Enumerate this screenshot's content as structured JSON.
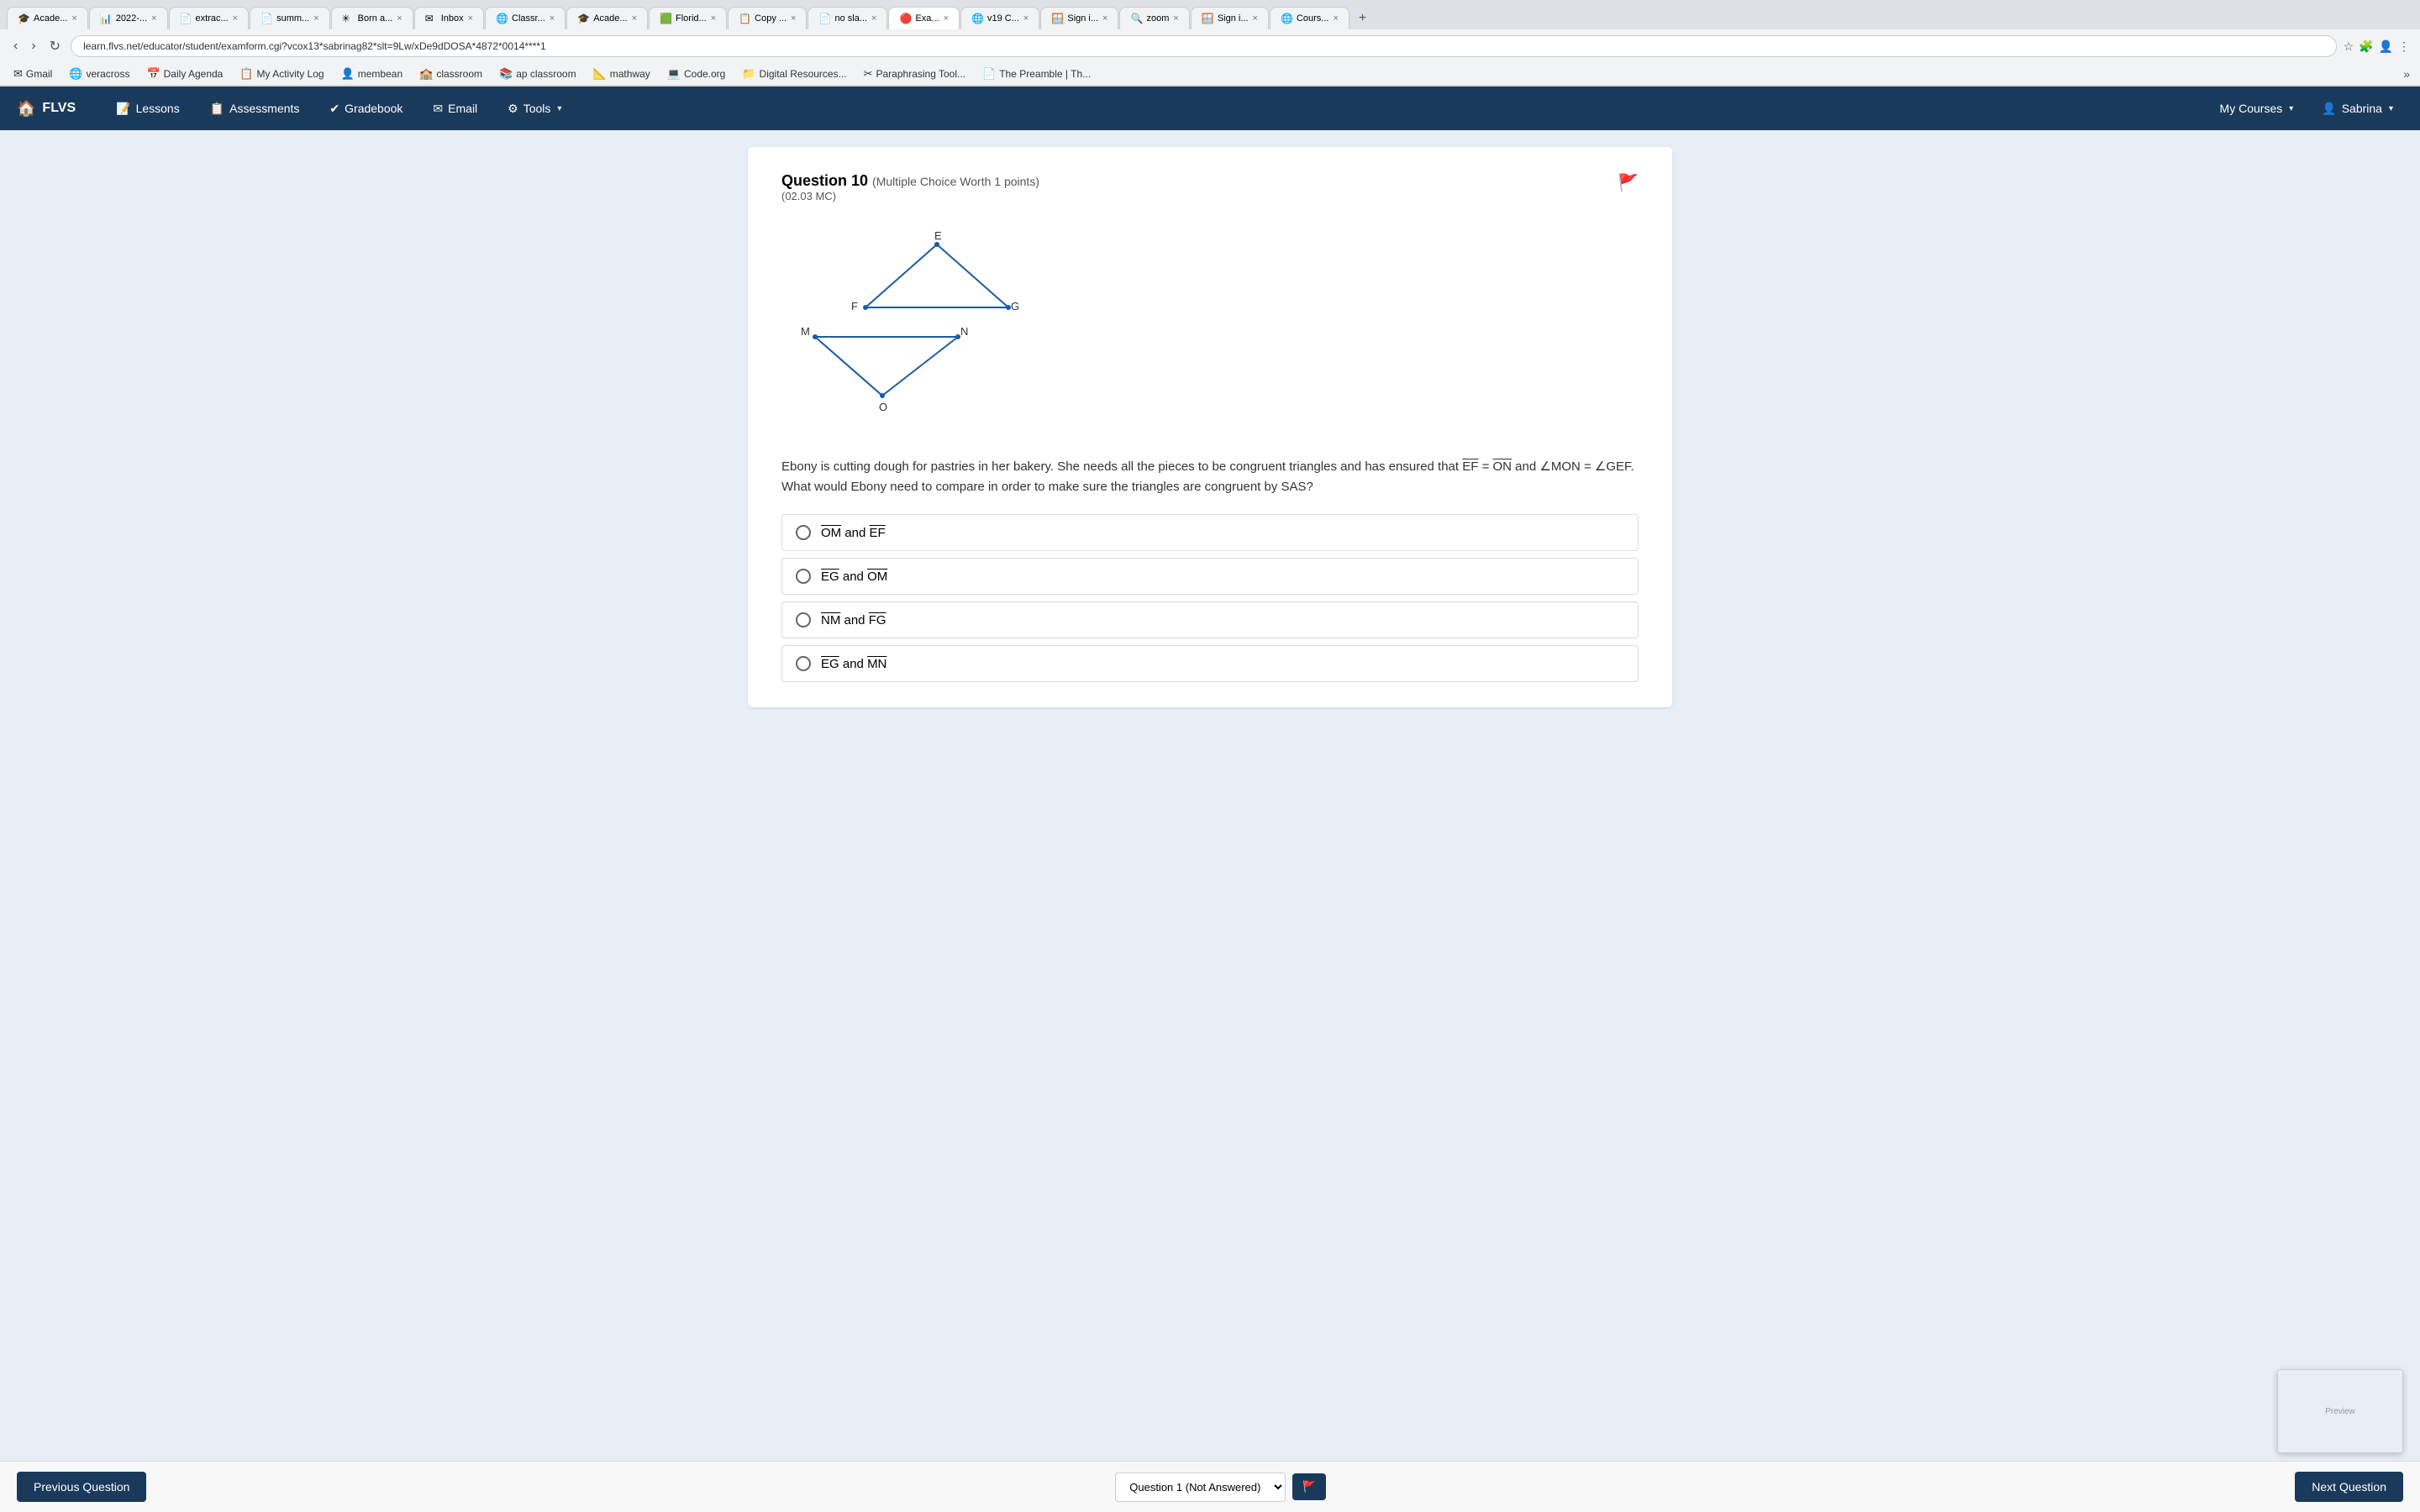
{
  "browser": {
    "tabs": [
      {
        "id": "t1",
        "favicon": "🎓",
        "title": "Acade...",
        "active": false
      },
      {
        "id": "t2",
        "favicon": "📊",
        "title": "2022-...",
        "active": false
      },
      {
        "id": "t3",
        "favicon": "📄",
        "title": "extrac...",
        "active": false
      },
      {
        "id": "t4",
        "favicon": "📄",
        "title": "summ...",
        "active": false
      },
      {
        "id": "t5",
        "favicon": "✳",
        "title": "Born a...",
        "active": false
      },
      {
        "id": "t6",
        "favicon": "✉",
        "title": "Inbox",
        "active": false
      },
      {
        "id": "t7",
        "favicon": "🌐",
        "title": "Classr...",
        "active": false
      },
      {
        "id": "t8",
        "favicon": "🎓",
        "title": "Acade...",
        "active": false
      },
      {
        "id": "t9",
        "favicon": "🟩",
        "title": "Florid...",
        "active": false
      },
      {
        "id": "t10",
        "favicon": "📋",
        "title": "Copy ...",
        "active": false
      },
      {
        "id": "t11",
        "favicon": "📄",
        "title": "no sla...",
        "active": false
      },
      {
        "id": "t12",
        "favicon": "🔴",
        "title": "Exa...",
        "active": true
      },
      {
        "id": "t13",
        "favicon": "🌐",
        "title": "v19 C...",
        "active": false
      },
      {
        "id": "t14",
        "favicon": "🪟",
        "title": "Sign i...",
        "active": false
      },
      {
        "id": "t15",
        "favicon": "🔍",
        "title": "zoom",
        "active": false
      },
      {
        "id": "t16",
        "favicon": "🪟",
        "title": "Sign i...",
        "active": false
      },
      {
        "id": "t17",
        "favicon": "🌐",
        "title": "Cours...",
        "active": false
      }
    ],
    "url": "learn.flvs.net/educator/student/examform.cgi?vcox13*sabrinag82*slt=9Lw/xDe9dDOSA*4872*0014****1"
  },
  "bookmarks": [
    {
      "icon": "✉",
      "label": "Gmail"
    },
    {
      "icon": "🌐",
      "label": "veracross"
    },
    {
      "icon": "📅",
      "label": "Daily Agenda"
    },
    {
      "icon": "📋",
      "label": "My Activity Log"
    },
    {
      "icon": "👤",
      "label": "membean"
    },
    {
      "icon": "🏫",
      "label": "classroom"
    },
    {
      "icon": "📚",
      "label": "ap classroom"
    },
    {
      "icon": "📐",
      "label": "mathway"
    },
    {
      "icon": "💻",
      "label": "Code.org"
    },
    {
      "icon": "📁",
      "label": "Digital Resources..."
    },
    {
      "icon": "✂",
      "label": "Paraphrasing Tool..."
    },
    {
      "icon": "📄",
      "label": "The Preamble | Th..."
    }
  ],
  "nav": {
    "brand": "FLVS",
    "links": [
      {
        "icon": "📝",
        "label": "Lessons"
      },
      {
        "icon": "📋",
        "label": "Assessments"
      },
      {
        "icon": "✔",
        "label": "Gradebook"
      },
      {
        "icon": "✉",
        "label": "Email"
      },
      {
        "icon": "⚙",
        "label": "Tools",
        "dropdown": true
      }
    ],
    "right": [
      {
        "label": "My Courses",
        "dropdown": true
      },
      {
        "label": "Sabrina",
        "dropdown": true
      }
    ]
  },
  "question": {
    "number": "Question 10",
    "type": "(Multiple Choice Worth 1 points)",
    "code": "(02.03 MC)",
    "text": "Ebony is cutting dough for pastries in her bakery. She needs all the pieces to be congruent triangles and has ensured that",
    "text2": "= ",
    "text3": "and ∠MON = ∠GEF. What would Ebony need to compare in order to make sure the triangles are congruent by SAS?",
    "given1": "EF",
    "given2": "ON",
    "choices": [
      {
        "id": "a",
        "text1": "OM",
        "conj": " and ",
        "text2": "EF",
        "overline1": true,
        "overline2": true
      },
      {
        "id": "b",
        "text1": "EG",
        "conj": " and ",
        "text2": "OM",
        "overline1": true,
        "overline2": true
      },
      {
        "id": "c",
        "text1": "NM",
        "conj": " and ",
        "text2": "FG",
        "overline1": true,
        "overline2": true
      },
      {
        "id": "d",
        "text1": "EG",
        "conj": " and ",
        "text2": "MN",
        "overline1": true,
        "overline2": true
      }
    ]
  },
  "bottomNav": {
    "prev": "Previous Question",
    "next": "Next Question",
    "questionSelector": "Question 1 (Not Answered)",
    "flagLabel": "🚩"
  }
}
